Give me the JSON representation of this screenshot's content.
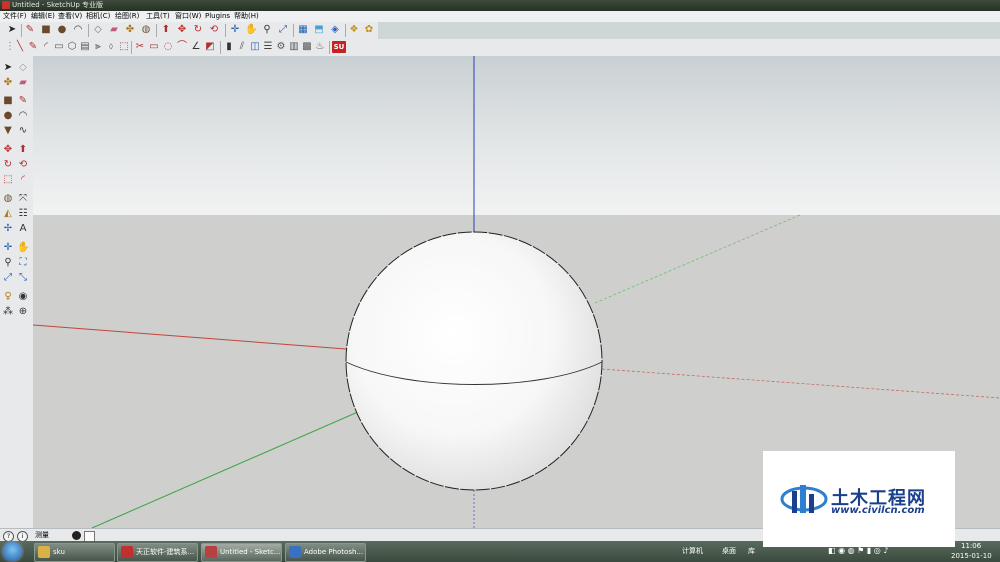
{
  "window": {
    "title": "Untitled - SketchUp 专业版"
  },
  "menu": {
    "items": [
      "文件(F)",
      "编辑(E)",
      "查看(V)",
      "相机(C)",
      "绘图(R)",
      "工具(T)",
      "窗口(W)",
      "Plugins",
      "帮助(H)"
    ]
  },
  "toolbar_top": {
    "icons": [
      "select-icon",
      "pencil-icon",
      "rectangle-icon",
      "circle-icon",
      "arc-icon",
      "make-component-icon",
      "eraser-icon",
      "paint-bucket-icon",
      "tape-measure-icon",
      "push-pull-icon",
      "move-icon",
      "rotate-icon",
      "offset-icon",
      "orbit-icon",
      "pan-icon",
      "zoom-icon",
      "zoom-extents-icon",
      "3d-warehouse-icon",
      "share-model-icon",
      "get-models-icon",
      "components-icon",
      "styles-icon"
    ]
  },
  "toolbar_second": {
    "icons": [
      "line-icon",
      "freehand-icon",
      "arc-tool-icon",
      "rectangle-tool-icon",
      "polygon-icon",
      "circle-tool-icon",
      "move-tool-icon",
      "rotate-tool-icon",
      "scale-icon",
      "follow-me-icon",
      "offset-tool-icon",
      "intersect-icon",
      "union-icon",
      "subtract-icon",
      "trim-icon",
      "split-icon",
      "dimension-icon",
      "protractor-icon",
      "axes-icon",
      "text-icon",
      "section-icon",
      "camera-icon",
      "walk-icon",
      "look-around-icon",
      "position-camera-icon",
      "su-plugin-icon"
    ],
    "badge": "SU"
  },
  "left_toolbar": {
    "icons": [
      "select-icon",
      "eraser-icon",
      "paint-icon",
      "eraser2-icon",
      "rectangle-icon",
      "line-icon",
      "circle-icon",
      "arc-icon",
      "polygon-icon",
      "freehand-icon",
      "move-icon",
      "push-pull-icon",
      "rotate-icon",
      "follow-me-icon",
      "scale-icon",
      "offset-icon",
      "tape-icon",
      "dimension-icon",
      "protractor-icon",
      "text-icon",
      "axes-icon",
      "3d-text-icon",
      "orbit-icon",
      "pan-icon",
      "zoom-icon",
      "zoom-window-icon",
      "zoom-extents-icon",
      "previous-icon",
      "position-camera-icon",
      "look-around-icon",
      "walk-icon",
      "section-plane-icon"
    ]
  },
  "statusbar": {
    "measure_label": "测量"
  },
  "taskbar": {
    "items": [
      {
        "label": "sku",
        "color": "#d9b247"
      },
      {
        "label": "天正软件-建筑系...",
        "color": "#c03030"
      },
      {
        "label": "Untitled - Sketc...",
        "color": "#b84040"
      },
      {
        "label": "Adobe Photosh...",
        "color": "#3a70c0"
      }
    ],
    "tray_text_1": "计算机",
    "tray_text_2": "桌面",
    "tray_text_3": "库",
    "time": "11:06",
    "date": "2015-01-10"
  },
  "watermark": {
    "title": "土木工程网",
    "url": "www.civilcn.com"
  },
  "colors": {
    "sky_top": "#cfd6d8",
    "sky_horizon": "#f1f3f3",
    "ground": "#cfcfcd",
    "axis_red": "#c0453c",
    "axis_green": "#3aa446",
    "axis_blue": "#2a3fb6"
  }
}
